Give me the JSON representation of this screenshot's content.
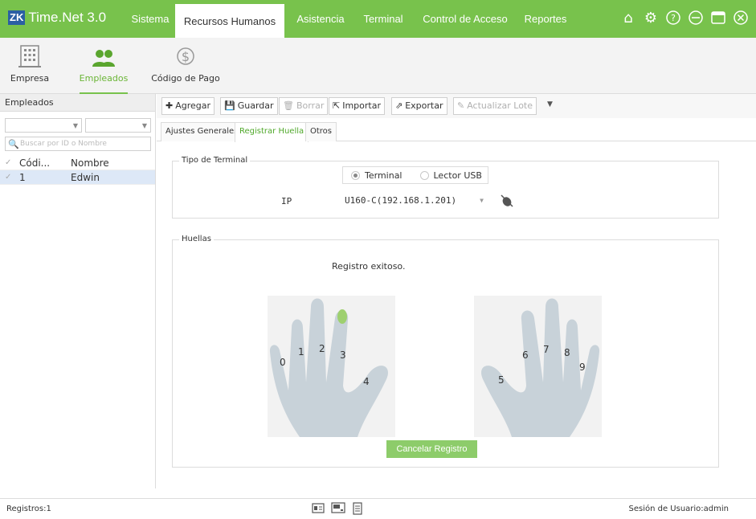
{
  "app": {
    "logo_mark": "ZK",
    "title": "Time.Net 3.0"
  },
  "nav": [
    {
      "label": "Sistema"
    },
    {
      "label": "Recursos Humanos"
    },
    {
      "label": "Asistencia"
    },
    {
      "label": "Terminal"
    },
    {
      "label": "Control de Acceso"
    },
    {
      "label": "Reportes"
    }
  ],
  "window_icons": [
    "home-icon",
    "settings-icon",
    "help-icon",
    "minimize-icon",
    "maximize-icon",
    "close-icon"
  ],
  "modules": [
    {
      "label": "Empresa",
      "icon": "building-icon"
    },
    {
      "label": "Empleados",
      "icon": "people-icon"
    },
    {
      "label": "Código de Pago",
      "icon": "dollar-icon"
    }
  ],
  "left_panel": {
    "title": "Empleados",
    "search_placeholder": "Buscar por ID o Nombre",
    "columns": [
      "Códi...",
      "Nombre"
    ],
    "rows": [
      {
        "code": "1",
        "name": "Edwin"
      }
    ]
  },
  "toolbar": {
    "add": "Agregar",
    "save": "Guardar",
    "delete": "Borrar",
    "import": "Importar",
    "export": "Exportar",
    "batch_update": "Actualizar Lote"
  },
  "tabs": [
    {
      "label": "Ajustes Generales"
    },
    {
      "label": "Registrar Huella"
    },
    {
      "label": "Otros"
    }
  ],
  "terminal_type": {
    "legend": "Tipo de Terminal",
    "option_terminal": "Terminal",
    "option_usb": "Lector USB",
    "ip_label": "IP",
    "ip_value": "U160-C(192.168.1.201)"
  },
  "fingerprints": {
    "legend": "Huellas",
    "status": "Registro exitoso.",
    "left_fingers": [
      "0",
      "1",
      "2",
      "3",
      "4"
    ],
    "right_fingers": [
      "5",
      "6",
      "7",
      "8",
      "9"
    ],
    "cancel_label": "Cancelar Registro"
  },
  "statusbar": {
    "records": "Registros:1",
    "session": "Sesión de Usuario:admin"
  },
  "colors": {
    "accent": "#78c24c",
    "active_text": "#4fa82a",
    "button_green": "#8dcc6a"
  }
}
